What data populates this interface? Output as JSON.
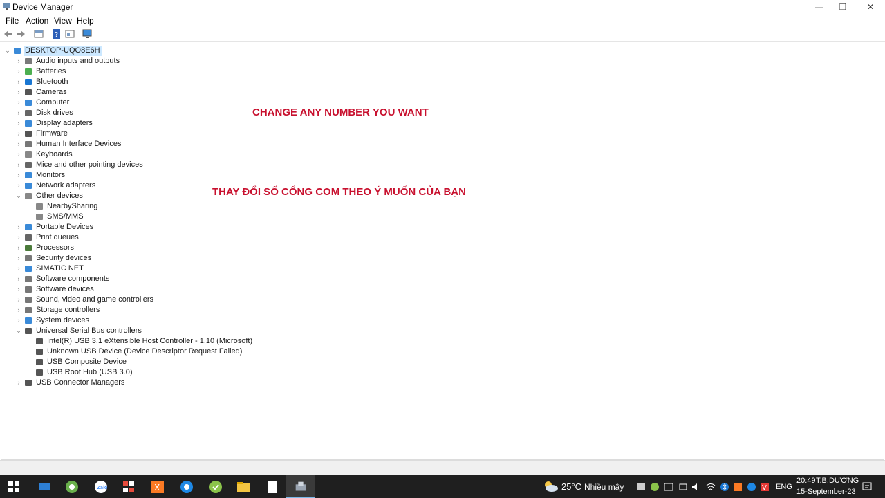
{
  "window": {
    "title": "Device Manager",
    "controls": {
      "minimize": "—",
      "maximize": "❐",
      "close": "✕"
    }
  },
  "menu": [
    "File",
    "Action",
    "View",
    "Help"
  ],
  "toolbar": [
    "back-icon",
    "forward-icon",
    "properties-icon",
    "help-icon",
    "console-icon",
    "monitor-icon"
  ],
  "tree": {
    "root": "DESKTOP-UQO8E6H",
    "categories": [
      {
        "label": "Audio inputs and outputs",
        "icon": "speaker-icon",
        "expanded": false
      },
      {
        "label": "Batteries",
        "icon": "battery-icon",
        "expanded": false
      },
      {
        "label": "Bluetooth",
        "icon": "bluetooth-icon",
        "expanded": false
      },
      {
        "label": "Cameras",
        "icon": "camera-icon",
        "expanded": false
      },
      {
        "label": "Computer",
        "icon": "computer-icon",
        "expanded": false
      },
      {
        "label": "Disk drives",
        "icon": "disk-icon",
        "expanded": false
      },
      {
        "label": "Display adapters",
        "icon": "display-adapter-icon",
        "expanded": false
      },
      {
        "label": "Firmware",
        "icon": "firmware-icon",
        "expanded": false
      },
      {
        "label": "Human Interface Devices",
        "icon": "hid-icon",
        "expanded": false
      },
      {
        "label": "Keyboards",
        "icon": "keyboard-icon",
        "expanded": false
      },
      {
        "label": "Mice and other pointing devices",
        "icon": "mouse-icon",
        "expanded": false
      },
      {
        "label": "Monitors",
        "icon": "monitor-icon",
        "expanded": false
      },
      {
        "label": "Network adapters",
        "icon": "network-icon",
        "expanded": false
      },
      {
        "label": "Other devices",
        "icon": "unknown-device-icon",
        "expanded": true,
        "children": [
          "NearbySharing",
          "SMS/MMS"
        ]
      },
      {
        "label": "Portable Devices",
        "icon": "portable-device-icon",
        "expanded": false
      },
      {
        "label": "Print queues",
        "icon": "printer-icon",
        "expanded": false
      },
      {
        "label": "Processors",
        "icon": "processor-icon",
        "expanded": false
      },
      {
        "label": "Security devices",
        "icon": "security-device-icon",
        "expanded": false
      },
      {
        "label": "SIMATIC NET",
        "icon": "simatic-net-icon",
        "expanded": false
      },
      {
        "label": "Software components",
        "icon": "software-component-icon",
        "expanded": false
      },
      {
        "label": "Software devices",
        "icon": "software-device-icon",
        "expanded": false
      },
      {
        "label": "Sound, video and game controllers",
        "icon": "sound-icon",
        "expanded": false
      },
      {
        "label": "Storage controllers",
        "icon": "storage-icon",
        "expanded": false
      },
      {
        "label": "System devices",
        "icon": "system-device-icon",
        "expanded": false
      },
      {
        "label": "Universal Serial Bus controllers",
        "icon": "usb-icon",
        "expanded": true,
        "children": [
          "Intel(R) USB 3.1 eXtensible Host Controller - 1.10 (Microsoft)",
          "Unknown USB Device (Device Descriptor Request Failed)",
          "USB Composite Device",
          "USB Root Hub (USB 3.0)"
        ]
      },
      {
        "label": "USB Connector Managers",
        "icon": "usb-icon",
        "expanded": false
      }
    ]
  },
  "overlays": {
    "english": "CHANGE ANY NUMBER YOU WANT",
    "vietnamese": "THAY ĐỔI SỐ CỔNG COM THEO Ý MUỐN CỦA BẠN",
    "color": "#c8102e"
  },
  "taskbar": {
    "weather_temp": "25°C",
    "weather_text": "Nhiều mây",
    "language": "ENG",
    "time": "20:49",
    "user": "T.B.DƯƠNG",
    "date": "15-September-23"
  },
  "colors": {
    "selection": "#cce8ff",
    "taskbar": "#1f1f1f"
  }
}
